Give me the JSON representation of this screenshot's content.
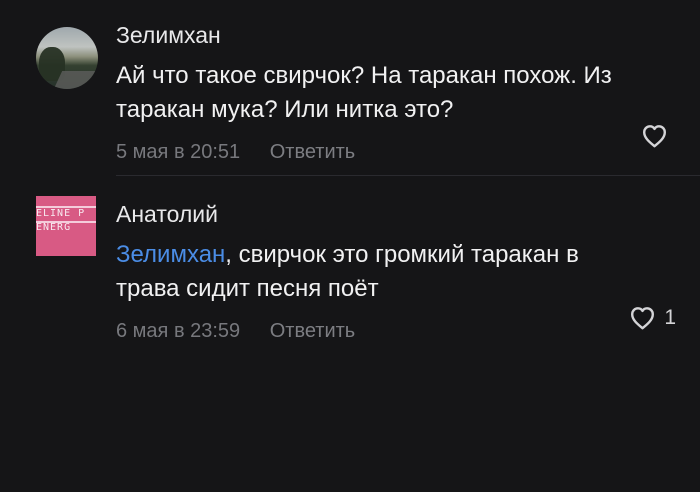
{
  "comments": [
    {
      "author": "Зелимхан",
      "avatar_icon": "profile-photo-avatar",
      "text_line_1": "Ай что такое свирчок? На таракан похож. Из",
      "text_line_2": "таракан мука? Или нитка это?",
      "timestamp": "5 мая в 20:51",
      "reply_label": "Ответить",
      "like_icon": "heart-outline-icon",
      "like_count": ""
    },
    {
      "author": "Анатолий",
      "avatar_icon": "pink-brand-avatar",
      "avatar_text_1": "ELINE P",
      "avatar_text_2": "ENERG",
      "mention": "Зелимхан",
      "text_line_1_rest": ", свирчок это громкий таракан в",
      "text_line_2": "трава сидит песня поёт",
      "timestamp": "6 мая в 23:59",
      "reply_label": "Ответить",
      "like_icon": "heart-outline-icon",
      "like_count": "1"
    }
  ],
  "colors": {
    "background": "#151517",
    "text_primary": "#f1f1f2",
    "text_secondary": "#77787d",
    "mention": "#4b8de6",
    "divider": "#2a2a2f",
    "avatar_accent": "#d85a84"
  }
}
